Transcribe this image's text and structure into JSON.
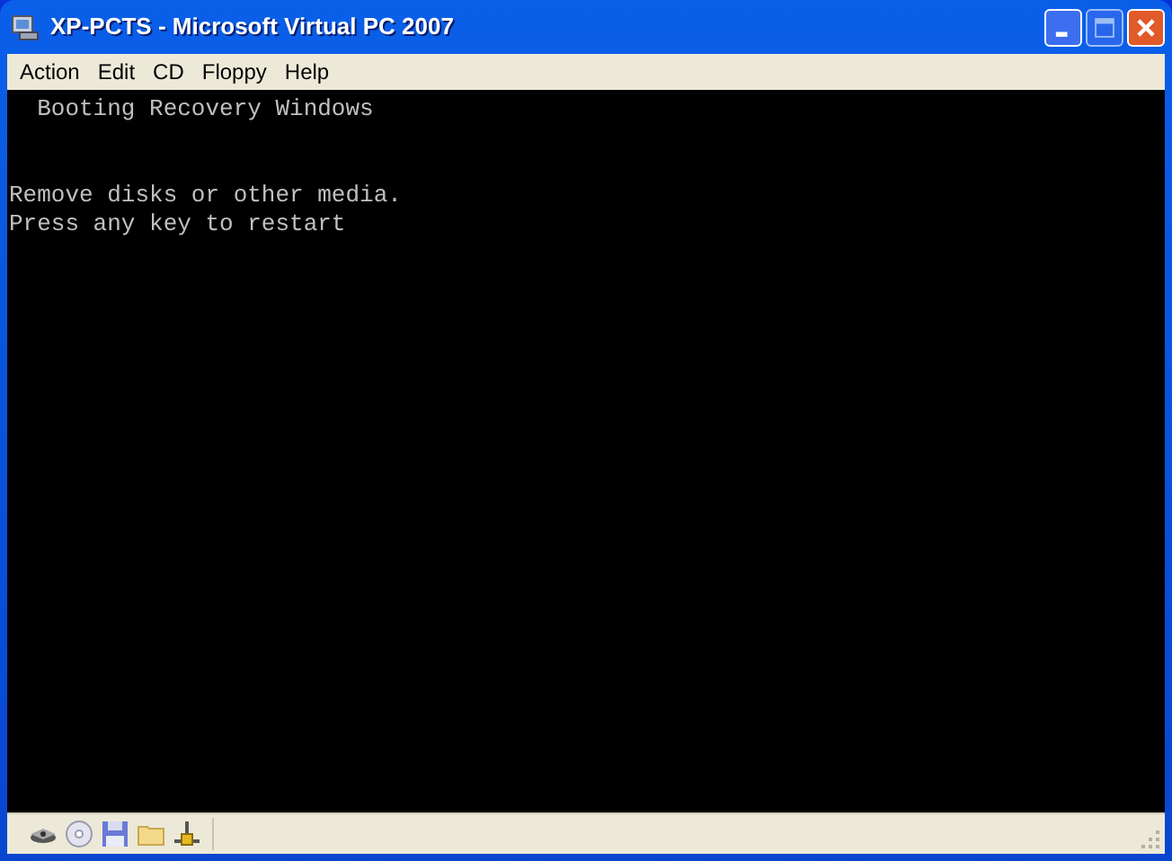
{
  "window": {
    "title": "XP-PCTS - Microsoft Virtual PC 2007",
    "buttons": [
      {
        "kind": "minimize",
        "disabled": false
      },
      {
        "kind": "maximize",
        "disabled": true
      },
      {
        "kind": "close",
        "disabled": false
      }
    ]
  },
  "menu": [
    "Action",
    "Edit",
    "CD",
    "Floppy",
    "Help"
  ],
  "console": {
    "header": "  Booting Recovery Windows",
    "message": [
      "Remove disks or other media.",
      "Press any key to restart"
    ]
  },
  "status_bar": {
    "icons": [
      {
        "kind": "harddisk"
      },
      {
        "kind": "cd"
      },
      {
        "kind": "floppy"
      },
      {
        "kind": "folder"
      },
      {
        "kind": "network"
      }
    ]
  }
}
